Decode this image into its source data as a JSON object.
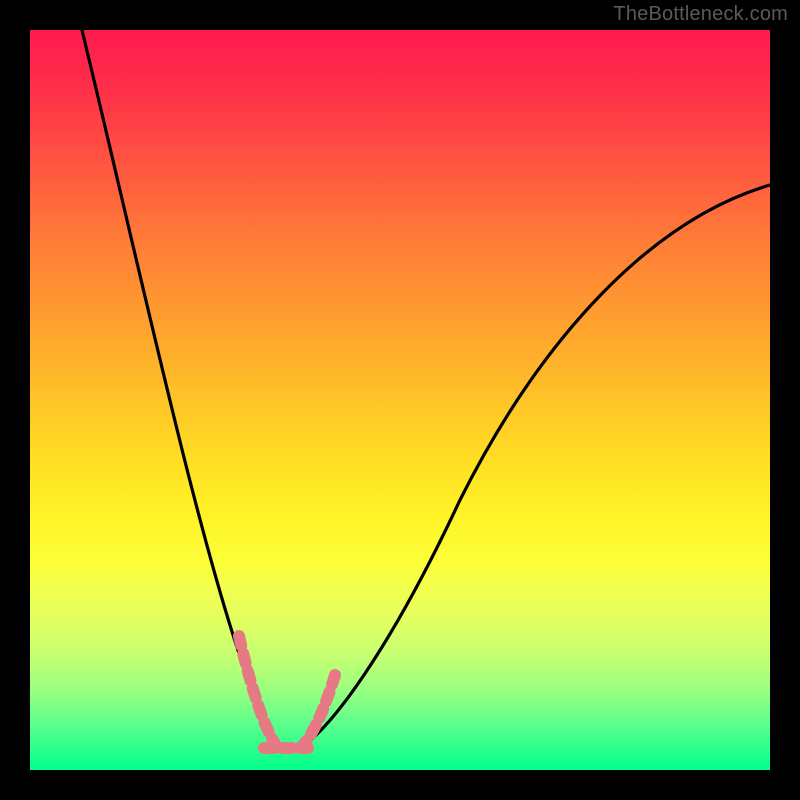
{
  "watermark": "TheBottleneck.com",
  "chart_data": {
    "type": "line",
    "title": "",
    "xlabel": "",
    "ylabel": "",
    "xlim": [
      0,
      100
    ],
    "ylim": [
      0,
      100
    ],
    "grid": false,
    "legend": false,
    "left_branch": {
      "x_start": 7,
      "y_start": 100,
      "x_min": 32,
      "y_min": 3
    },
    "right_branch": {
      "x_min": 37,
      "y_min": 3,
      "x_end": 100,
      "y_end": 79
    },
    "highlight_segments": [
      {
        "from": [
          28,
          18
        ],
        "to": [
          31.5,
          3.2
        ]
      },
      {
        "from": [
          31.5,
          3.2
        ],
        "to": [
          37,
          3.2
        ]
      },
      {
        "from": [
          37,
          3.2
        ],
        "to": [
          40.5,
          13
        ]
      }
    ],
    "gradient_stops": [
      {
        "pos": 0,
        "color": "#ff1a4d"
      },
      {
        "pos": 66,
        "color": "#fff428"
      },
      {
        "pos": 100,
        "color": "#00ff8c"
      }
    ]
  }
}
